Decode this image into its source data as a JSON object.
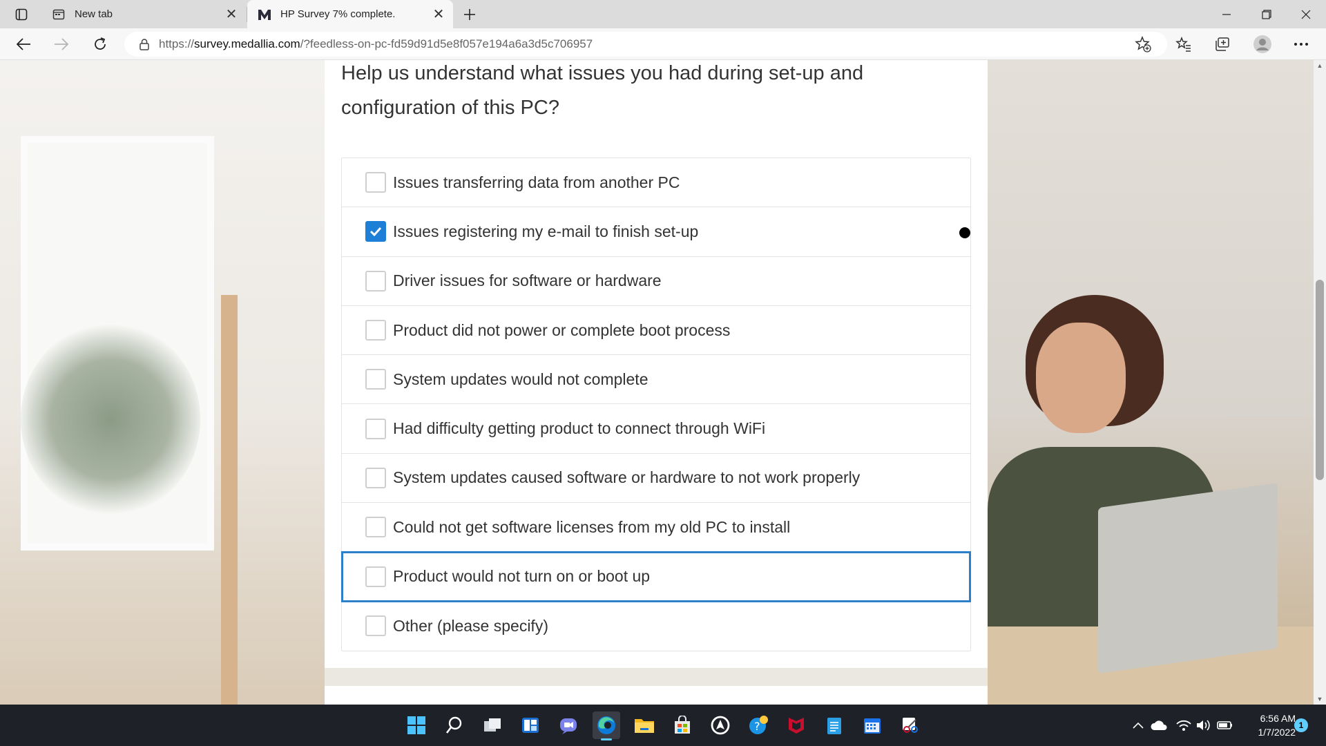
{
  "browser": {
    "tabs": [
      {
        "title": "New tab",
        "favicon": "new-tab-icon",
        "active": false
      },
      {
        "title": "HP Survey 7% complete.",
        "favicon": "medallia-icon",
        "active": true
      }
    ],
    "url_prefix": "https://",
    "url_host": "survey.medallia.com",
    "url_rest": "/?feedless-on-pc-fd59d91d5e8f057e194a6a3d5c706957",
    "load_progress": 0.07
  },
  "survey": {
    "question": "Help us understand what issues you had during set-up and configuration of this PC?",
    "options": [
      {
        "label": "Issues transferring data from another PC",
        "checked": false
      },
      {
        "label": "Issues registering my e-mail to finish set-up",
        "checked": true
      },
      {
        "label": "Driver issues for software or hardware",
        "checked": false
      },
      {
        "label": "Product did not power or complete boot process",
        "checked": false
      },
      {
        "label": "System updates would not complete",
        "checked": false
      },
      {
        "label": "Had difficulty getting product to connect through WiFi",
        "checked": false
      },
      {
        "label": "System updates caused software or hardware to not work properly",
        "checked": false
      },
      {
        "label": "Could not get software licenses from my old PC to install",
        "checked": false
      },
      {
        "label": "Product would not turn on or boot up",
        "checked": false,
        "focused": true
      },
      {
        "label": "Other (please specify)",
        "checked": false
      }
    ]
  },
  "taskbar": {
    "apps": [
      "start-icon",
      "search-icon",
      "task-view-icon",
      "widgets-icon",
      "chat-icon",
      "edge-icon",
      "file-explorer-icon",
      "store-icon",
      "app-icon",
      "help-icon",
      "mcafee-icon",
      "notepad-icon",
      "calendar-icon",
      "snipping-tool-icon"
    ],
    "time": "6:56 AM",
    "date": "1/7/2022",
    "notifications": "1"
  },
  "colors": {
    "accent": "#1d7fd6",
    "focus": "#2c7fc9",
    "progress": "#3db54a"
  }
}
